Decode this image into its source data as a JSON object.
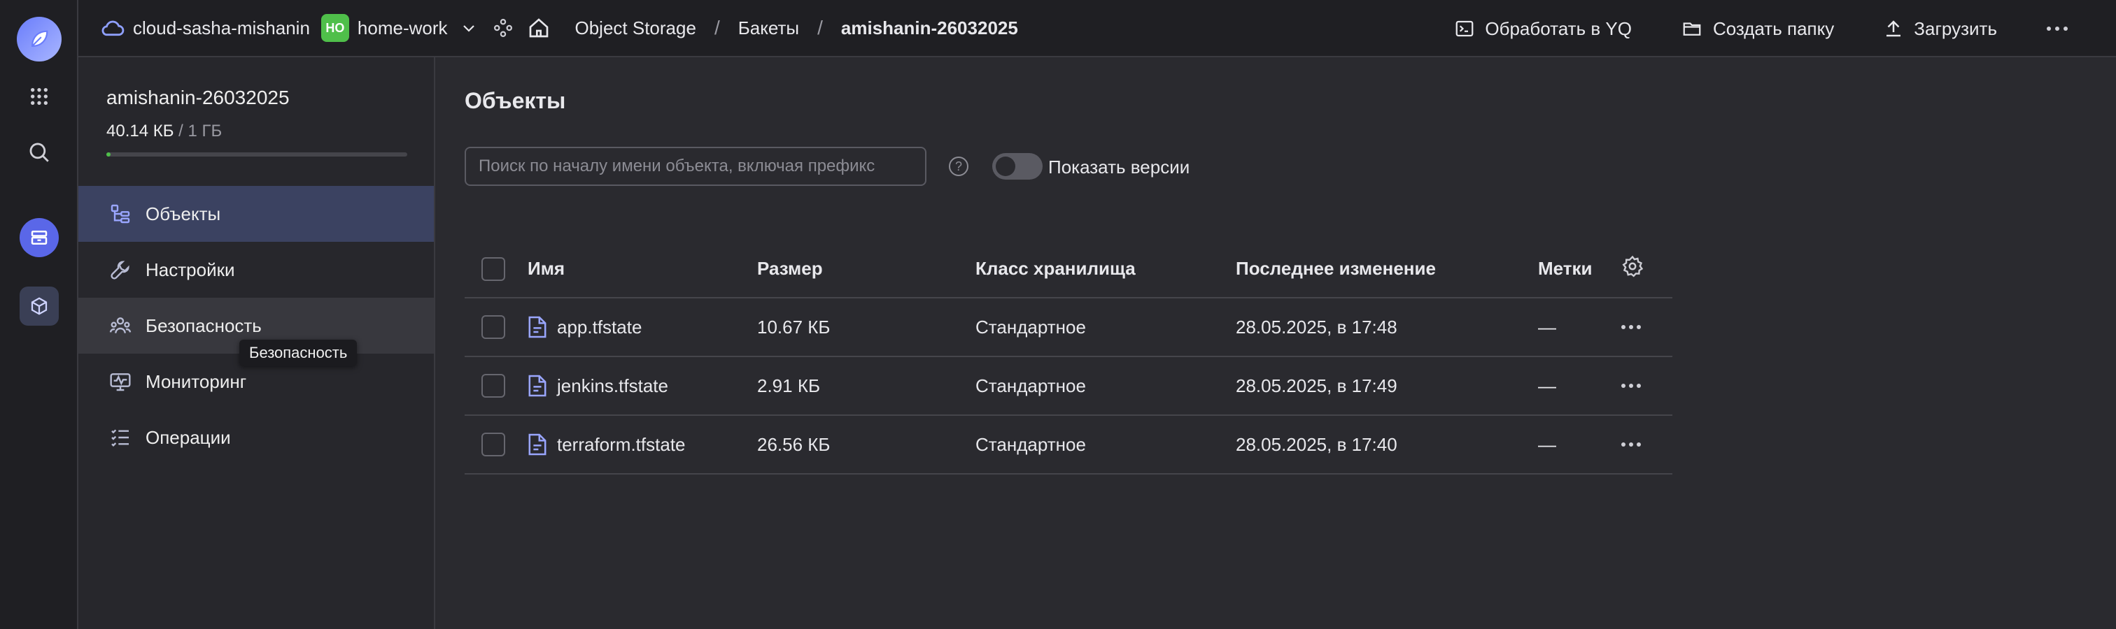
{
  "topbar": {
    "cloud_name": "cloud-sasha-mishanin",
    "folder_badge": "HO",
    "folder_name": "home-work",
    "service": "Object Storage",
    "section": "Бакеты",
    "bucket": "amishanin-26032025",
    "actions": {
      "process_yq": "Обработать в YQ",
      "create_folder": "Создать папку",
      "upload": "Загрузить"
    }
  },
  "sidebar": {
    "bucket_name": "amishanin-26032025",
    "usage_used": "40.14 КБ",
    "usage_total": " / 1 ГБ",
    "usage_fraction": 4e-05,
    "items": [
      {
        "label": "Объекты"
      },
      {
        "label": "Настройки"
      },
      {
        "label": "Безопасность"
      },
      {
        "label": "Мониторинг"
      },
      {
        "label": "Операции"
      }
    ],
    "tooltip": "Безопасность"
  },
  "main": {
    "title": "Объекты",
    "search_placeholder": "Поиск по началу имени объекта, включая префикс",
    "help": "?",
    "show_versions": "Показать версии",
    "columns": {
      "name": "Имя",
      "size": "Размер",
      "storage_class": "Класс хранилища",
      "modified": "Последнее изменение",
      "tags": "Метки"
    },
    "rows": [
      {
        "name": "app.tfstate",
        "size": "10.67 КБ",
        "class": "Стандартное",
        "modified": "28.05.2025, в 17:48",
        "tags": "—"
      },
      {
        "name": "jenkins.tfstate",
        "size": "2.91 КБ",
        "class": "Стандартное",
        "modified": "28.05.2025, в 17:49",
        "tags": "—"
      },
      {
        "name": "terraform.tfstate",
        "size": "26.56 КБ",
        "class": "Стандартное",
        "modified": "28.05.2025, в 17:40",
        "tags": "—"
      }
    ]
  },
  "colors": {
    "accent": "#5a67e8",
    "badge": "#4fbf4a",
    "active_nav": "#3b4261"
  }
}
